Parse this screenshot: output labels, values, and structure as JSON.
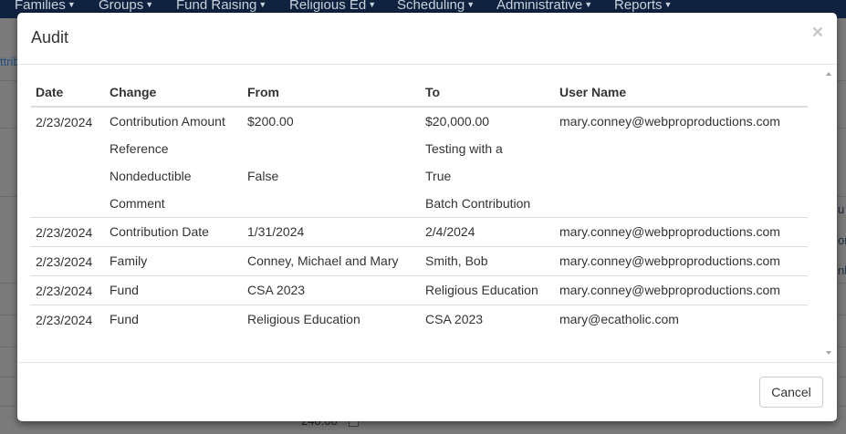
{
  "nav": {
    "items": [
      {
        "label": "Families",
        "name": "nav-families"
      },
      {
        "label": "Groups",
        "name": "nav-groups"
      },
      {
        "label": "Fund Raising",
        "name": "nav-fund-raising"
      },
      {
        "label": "Religious Ed",
        "name": "nav-religious-ed"
      },
      {
        "label": "Scheduling",
        "name": "nav-scheduling"
      },
      {
        "label": "Administrative",
        "name": "nav-administrative"
      },
      {
        "label": "Reports",
        "name": "nav-reports"
      }
    ]
  },
  "background": {
    "partial_link": "ttrib",
    "right_fragments": [
      "u",
      "or",
      "nl"
    ],
    "amount": "240.00"
  },
  "modal": {
    "title": "Audit",
    "close_symbol": "×",
    "columns": [
      "Date",
      "Change",
      "From",
      "To",
      "User Name"
    ],
    "rows": [
      {
        "date": "2/23/2024",
        "changes": [
          "Contribution Amount",
          "Reference",
          "Nondeductible",
          "Comment"
        ],
        "from": [
          "$200.00",
          "",
          "False",
          ""
        ],
        "to": [
          "$20,000.00",
          "Testing with a",
          "True",
          "Batch Contribution"
        ],
        "user": "mary.conney@webproproductions.com"
      },
      {
        "date": "2/23/2024",
        "changes": [
          "Contribution Date"
        ],
        "from": [
          "1/31/2024"
        ],
        "to": [
          "2/4/2024"
        ],
        "user": "mary.conney@webproproductions.com"
      },
      {
        "date": "2/23/2024",
        "changes": [
          "Family"
        ],
        "from": [
          "Conney, Michael and Mary"
        ],
        "to": [
          "Smith, Bob"
        ],
        "user": "mary.conney@webproproductions.com"
      },
      {
        "date": "2/23/2024",
        "changes": [
          "Fund"
        ],
        "from": [
          "CSA 2023"
        ],
        "to": [
          "Religious Education"
        ],
        "user": "mary.conney@webproproductions.com"
      },
      {
        "date": "2/23/2024",
        "changes": [
          "Fund"
        ],
        "from": [
          "Religious Education"
        ],
        "to": [
          "CSA 2023"
        ],
        "user": "mary@ecatholic.com"
      }
    ],
    "cancel_label": "Cancel"
  },
  "colors": {
    "navbar": "#0f2340",
    "backdrop": "#7b7b7b",
    "border": "#dddddd"
  }
}
